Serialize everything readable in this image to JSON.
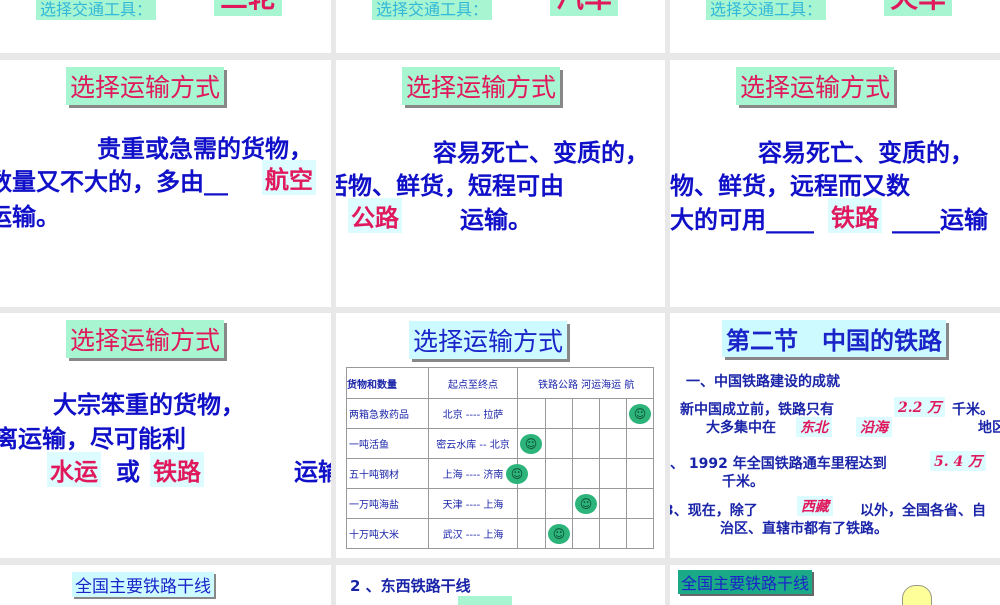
{
  "row0": [
    {
      "label": "选择交通工具：",
      "word": "三轮"
    },
    {
      "label": "选择交通工具：",
      "word": "汽车"
    },
    {
      "label": "选择交通工具：",
      "word": "火车"
    }
  ],
  "slide_title": "选择运输方式",
  "s1": {
    "l1": "贵重或急需的货物，",
    "l2": "数量又不大的，多由__",
    "ans": "航空",
    "l3": "运输。"
  },
  "s2": {
    "l1": "容易死亡、变质的，",
    "l2": "活物、鲜货，短程可由",
    "ans": "公路",
    "l3": "运输。"
  },
  "s3": {
    "l1": "容易死亡、变质的，",
    "l2": "物、鲜货，远程而又数",
    "l3a": "大的可用____",
    "ans": "铁路",
    "l3b": "____运输"
  },
  "s4": {
    "l1": "大宗笨重的货物，",
    "l2": "离运输，尽可能利",
    "ans1": "水运",
    "or": "或",
    "ans2": "铁路",
    "l3": "运输"
  },
  "s5": {
    "headers": [
      "货物和数量",
      "起点至终点",
      "铁路公路  河运海运  航"
    ],
    "rows": [
      {
        "goods": "两箱急救药品",
        "route": "北京 ---- 拉萨",
        "mode": 5
      },
      {
        "goods": "一吨活鱼",
        "route": "密云水库 -- 北京",
        "mode": 1
      },
      {
        "goods": "五十吨钢材",
        "route": "上海 ---- 济南",
        "mode": 0
      },
      {
        "goods": "一万吨海盐",
        "route": "天津 ---- 上海",
        "mode": 3
      },
      {
        "goods": "十万吨大米",
        "route": "武汉 ---- 上海",
        "mode": 2
      }
    ],
    "smile": "☺"
  },
  "s6": {
    "title": "第二节　中国的铁路",
    "h1": "一、中国铁路建设的成就",
    "p1a": "新中国成立前，铁路只有",
    "v1": "2.2 万",
    "p1b": "千米。",
    "p2a": "大多集中在",
    "v2a": "东北",
    "v2b": "沿海",
    "p2b": "地区",
    "p3a": "、 1992 年全国铁路通车里程达到",
    "v3": "5. 4 万",
    "p3b": "千米。",
    "p4a": "3、现在，除了",
    "v4": "西藏",
    "p4b": "以外，全国各省、自",
    "p4c": "治区、直辖市都有了铁路。"
  },
  "row3": {
    "t1": "全国主要铁路干线",
    "t2": "2 、东西铁路干线",
    "t3": "全国主要铁路干线"
  }
}
